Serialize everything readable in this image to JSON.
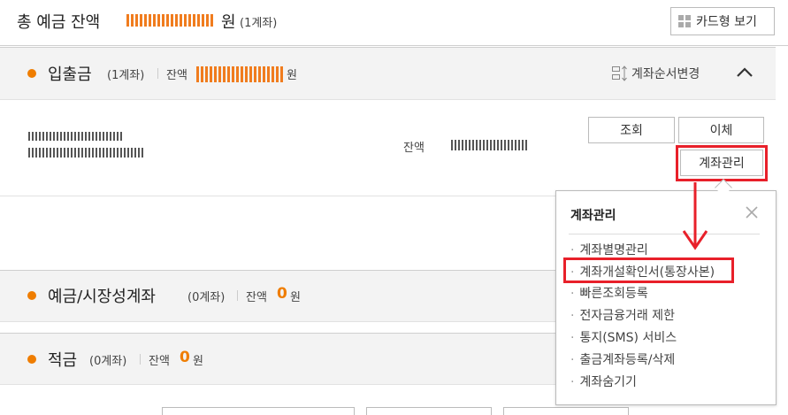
{
  "summary": {
    "total_label": "총 예금 잔액",
    "unit": "원",
    "account_count": "(1계좌)",
    "card_view_label": "카드형 보기"
  },
  "deposit_section": {
    "title": "입출금",
    "count": "(1계좌)",
    "balance_label": "잔액",
    "unit": "원",
    "order_change_label": "계좌순서변경"
  },
  "account": {
    "balance_label": "잔액",
    "buttons": {
      "inquiry": "조회",
      "transfer": "이체",
      "manage": "계좌관리"
    }
  },
  "manage_popup": {
    "title": "계좌관리",
    "items": [
      "계좌별명관리",
      "계좌개설확인서(통장사본)",
      "빠른조회등록",
      "전자금융거래 제한",
      "통지(SMS) 서비스",
      "출금계좌등록/삭제",
      "계좌숨기기"
    ]
  },
  "savings_section": {
    "title": "예금/시장성계좌",
    "count": "(0계좌)",
    "balance_label": "잔액",
    "balance_value": "0",
    "unit": "원"
  },
  "installment_section": {
    "title": "적금",
    "count": "(0계좌)",
    "balance_label": "잔액",
    "balance_value": "0",
    "unit": "원"
  },
  "colors": {
    "accent": "#ef7d00",
    "highlight": "#e8202a"
  }
}
